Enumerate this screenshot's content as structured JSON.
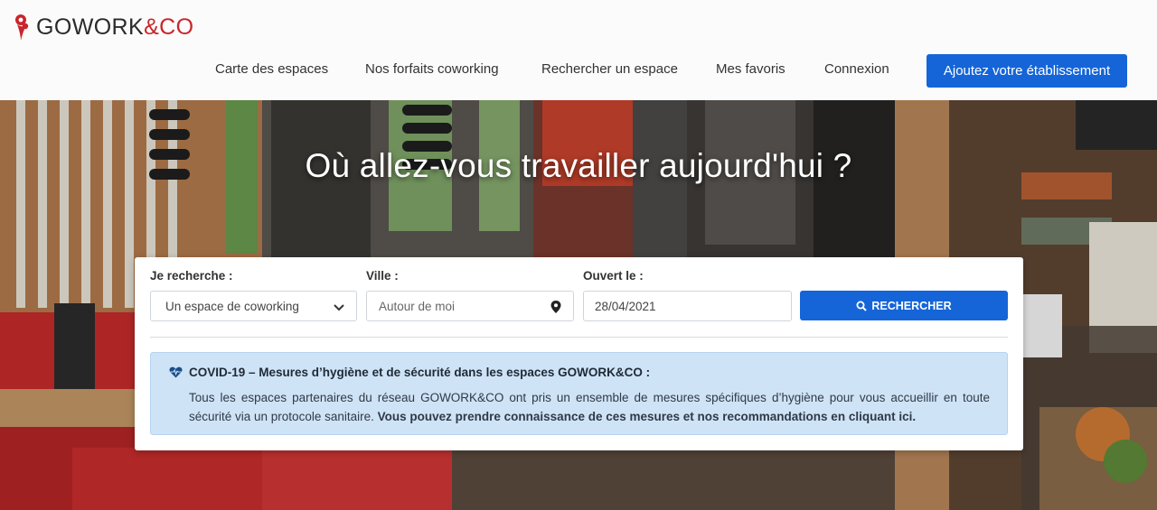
{
  "brand": {
    "logo_main": "GOWORK",
    "logo_accent": "&CO",
    "accent_color": "#c8262c",
    "primary_color": "#1565d8"
  },
  "nav": {
    "items": [
      {
        "label": "Carte des espaces"
      },
      {
        "label": "Nos forfaits coworking"
      },
      {
        "label": "Rechercher un espace"
      },
      {
        "label": "Mes favoris"
      },
      {
        "label": "Connexion"
      }
    ],
    "cta_label": "Ajoutez votre établissement"
  },
  "hero": {
    "title": "Où allez-vous travailler aujourd'hui ?"
  },
  "search": {
    "type_label": "Je recherche :",
    "type_value": "Un espace de coworking",
    "city_label": "Ville :",
    "city_placeholder": "Autour de moi",
    "open_label": "Ouvert le :",
    "open_value": "28/04/2021",
    "button_label": "RECHERCHER",
    "icons": [
      "chevron-down-icon",
      "location-pin-icon",
      "search-icon"
    ]
  },
  "notice": {
    "icon": "heartbeat-icon",
    "title": "COVID-19 – Mesures d’hygiène et de sécurité dans les espaces GOWORK&CO :",
    "body_text": "Tous les espaces partenaires du réseau GOWORK&CO ont pris un ensemble de mesures spécifiques d’hygiène pour vous accueillir en toute sécurité via un protocole sanitaire.",
    "body_bold": "Vous pouvez prendre connaissance de ces mesures et nos recommandations en cliquant ici."
  }
}
